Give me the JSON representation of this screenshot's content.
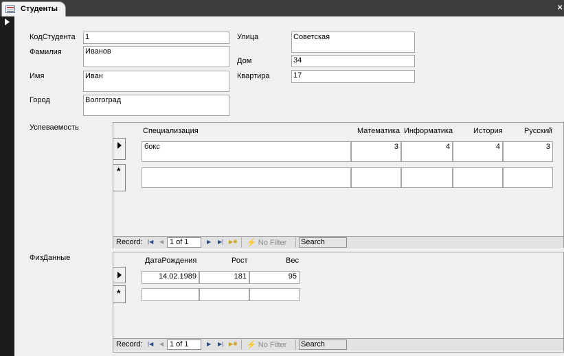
{
  "tab": {
    "title": "Студенты",
    "close": "×"
  },
  "fields": {
    "kod_label": "КодСтудента",
    "kod_value": "1",
    "familiya_label": "Фамилия",
    "familiya_value": "Иванов",
    "imya_label": "Имя",
    "imya_value": "Иван",
    "gorod_label": "Город",
    "gorod_value": "Волгоград",
    "ulica_label": "Улица",
    "ulica_value": "Советская",
    "dom_label": "Дом",
    "dom_value": "34",
    "kvartira_label": "Квартира",
    "kvartira_value": "17"
  },
  "uspevaemost": {
    "label": "Успеваемость",
    "columns": [
      "Специализация",
      "Математика",
      "Информатика",
      "История",
      "Русский"
    ],
    "rows": [
      [
        "бокс",
        "3",
        "4",
        "4",
        "3"
      ]
    ],
    "new_row_marker": "*",
    "nav": {
      "record_label": "Record:",
      "position": "1 of 1",
      "no_filter": "No Filter",
      "search": "Search"
    }
  },
  "fizdannye": {
    "label": "ФизДанные",
    "columns": [
      "ДатаРождения",
      "Рост",
      "Вес"
    ],
    "rows": [
      [
        "14.02.1989",
        "181",
        "95"
      ]
    ],
    "new_row_marker": "*",
    "nav": {
      "record_label": "Record:",
      "position": "1 of 1",
      "no_filter": "No Filter",
      "search": "Search"
    }
  },
  "icons": [
    "form-icon",
    "close-icon",
    "record-selector-icon",
    "first-record-icon",
    "prev-record-icon",
    "next-record-icon",
    "last-record-icon",
    "new-record-icon",
    "filter-icon"
  ]
}
